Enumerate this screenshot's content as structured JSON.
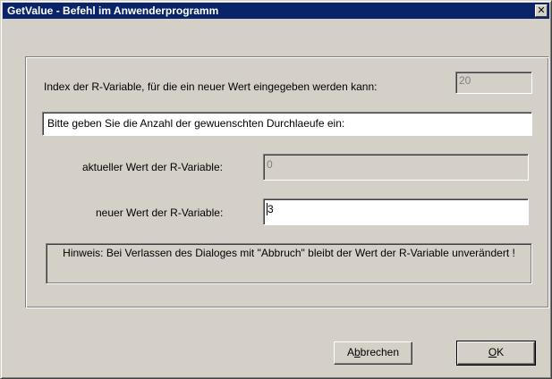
{
  "window": {
    "title": "GetValue - Befehl im Anwenderprogramm",
    "close_glyph": "✕"
  },
  "index_row": {
    "label": "Index der R-Variable, für die ein neuer Wert eingegeben werden kann:",
    "value": "20"
  },
  "prompt": {
    "text": "Bitte geben Sie die Anzahl der gewuenschten Durchlaeufe ein:"
  },
  "current_value": {
    "label": "aktueller Wert der R-Variable:",
    "value": "0"
  },
  "new_value": {
    "label": "neuer Wert der R-Variable:",
    "value": "3"
  },
  "hint": {
    "text": "Hinweis: Bei Verlassen des Dialoges mit \"Abbruch\" bleibt der Wert der R-Variable unverändert !"
  },
  "buttons": {
    "cancel_pre": "A",
    "cancel_accel": "b",
    "cancel_post": "brechen",
    "ok_accel": "O",
    "ok_post": "K"
  },
  "colors": {
    "titlebar": "#0a246a",
    "face": "#d4d0c8"
  }
}
